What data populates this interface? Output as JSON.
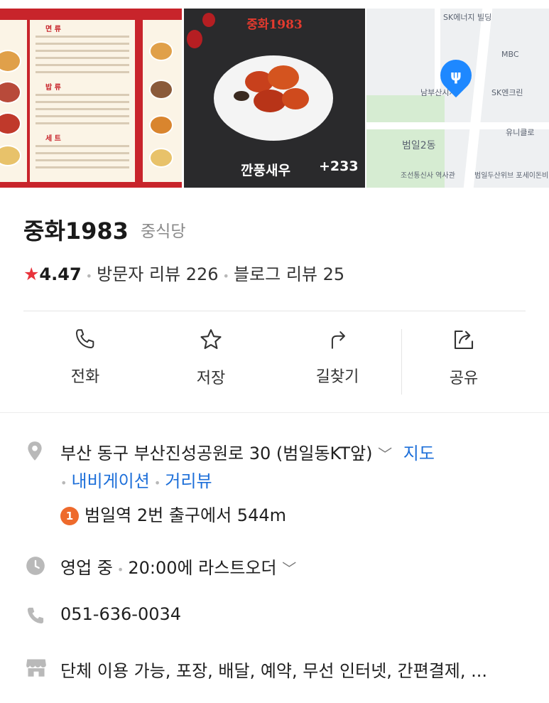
{
  "gallery": {
    "menu_headers": [
      "면 류",
      "밥 류",
      "세 트"
    ],
    "food_title": "중화1983",
    "food_label": "깐풍새우",
    "photo_count": "+233",
    "map_labels": [
      "SK에너지 빌딩",
      "MBC",
      "남부산시사",
      "SK엔크린",
      "유니클로",
      "범일2동",
      "조선통신사 역사관",
      "범일두산위브 포세이돈비아파트"
    ]
  },
  "place": {
    "name": "중화1983",
    "category": "중식당",
    "rating": "4.47",
    "visitor_reviews": "방문자 리뷰 226",
    "blog_reviews": "블로그 리뷰 25"
  },
  "actions": [
    {
      "label": "전화",
      "icon": "phone-icon"
    },
    {
      "label": "저장",
      "icon": "star-icon"
    },
    {
      "label": "길찾기",
      "icon": "directions-icon"
    },
    {
      "label": "공유",
      "icon": "share-icon"
    }
  ],
  "info": {
    "address": "부산 동구 부산진성공원로 30 (범일동KT앞)",
    "map_link": "지도",
    "navigation_link": "내비게이션",
    "street_view_link": "거리뷰",
    "exit_number": "1",
    "station_distance": "범일역 2번 출구에서 544m",
    "hours_status": "영업 중",
    "hours_detail": "20:00에 라스트오더",
    "phone": "051-636-0034",
    "amenities": "단체 이용 가능, 포장, 배달, 예약, 무선 인터넷, 간편결제, ..."
  },
  "colors": {
    "accent_blue": "#1d6fd9",
    "star_red": "#e8333b",
    "badge_orange": "#ee6a2c",
    "menu_red": "#c8242b"
  }
}
